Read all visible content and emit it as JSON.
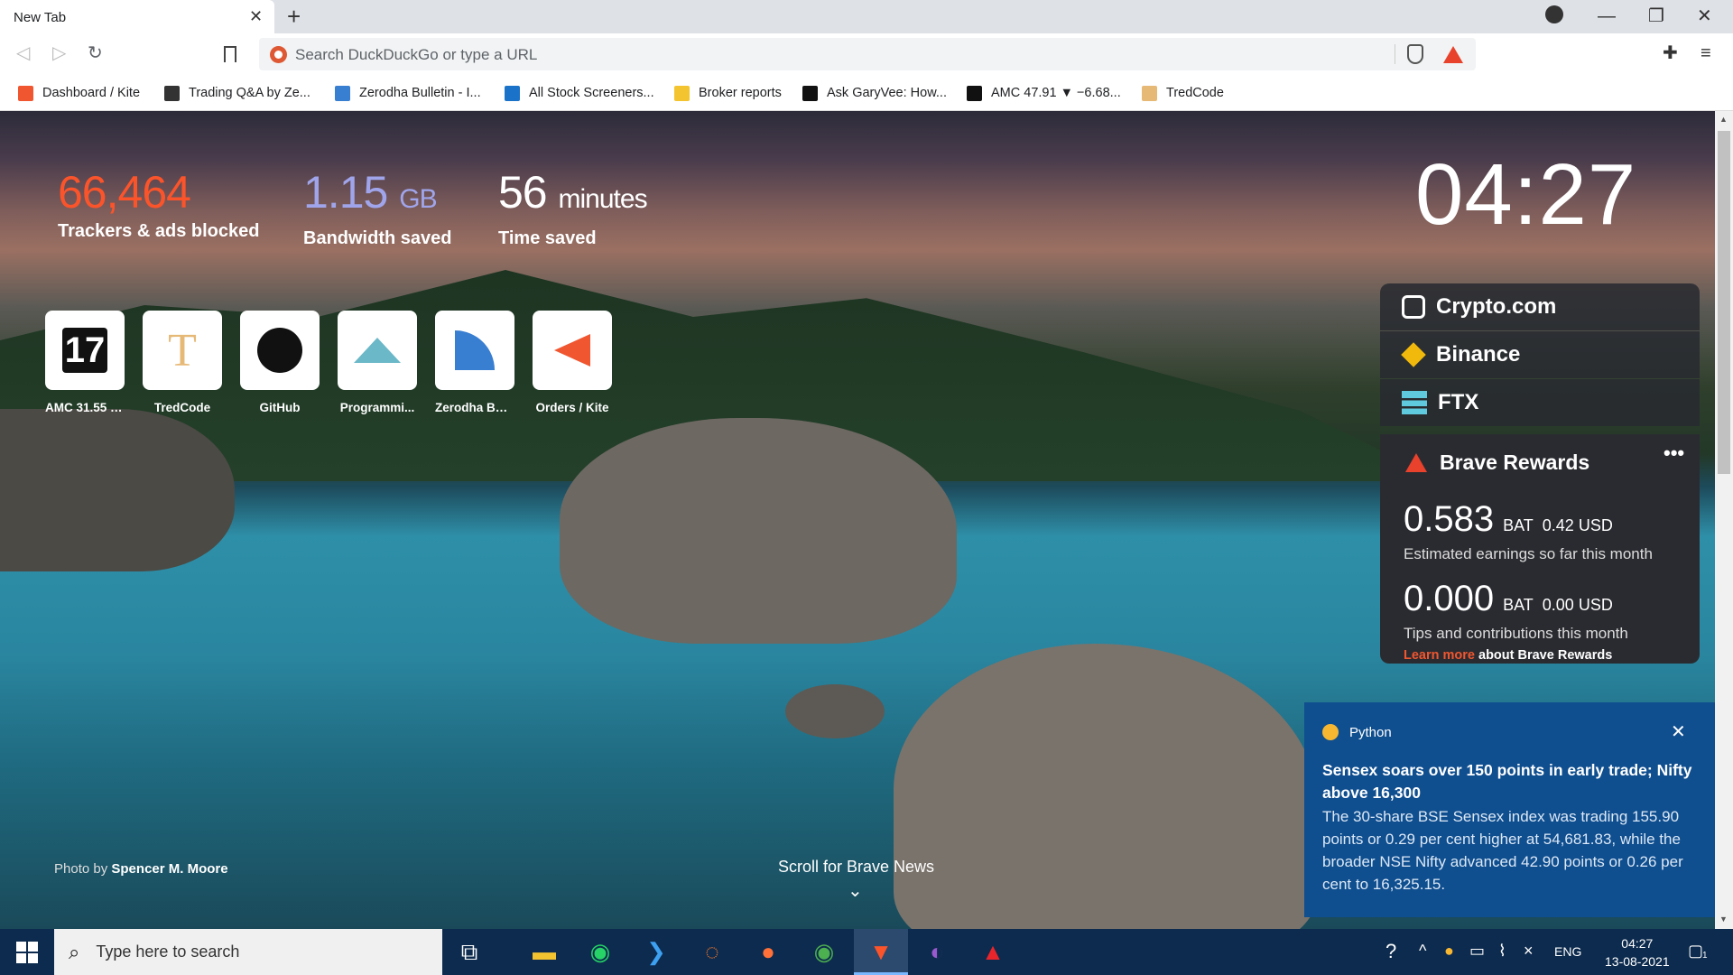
{
  "tab": {
    "title": "New Tab"
  },
  "omnibox": {
    "placeholder": "Search DuckDuckGo or type a URL"
  },
  "bookmarks": [
    {
      "label": "Dashboard / Kite",
      "icon": "kite-icon",
      "color": "#f0562f"
    },
    {
      "label": "Trading Q&A by Ze...",
      "icon": "tradingqa-icon",
      "color": "#333333"
    },
    {
      "label": "Zerodha Bulletin - I...",
      "icon": "zerodha-bulletin-icon",
      "color": "#387ed1"
    },
    {
      "label": "All Stock Screeners...",
      "icon": "chartink-icon",
      "color": "#1a73c8"
    },
    {
      "label": "Broker reports",
      "icon": "folder-icon",
      "color": "#f4c430"
    },
    {
      "label": "Ask GaryVee: How...",
      "icon": "garyvee-icon",
      "color": "#111111"
    },
    {
      "label": "AMC 47.91 ▼ −6.68...",
      "icon": "tradingview-icon",
      "color": "#111111"
    },
    {
      "label": "TredCode",
      "icon": "tredcode-icon",
      "color": "#e6b977"
    }
  ],
  "stats": {
    "trackers_value": "66,464",
    "trackers_label": "Trackers & ads blocked",
    "bandwidth_value": "1.15",
    "bandwidth_unit": "GB",
    "bandwidth_label": "Bandwidth saved",
    "time_value": "56",
    "time_unit": "minutes",
    "time_label": "Time saved",
    "trackers_color": "#fb542b",
    "bandwidth_color": "#a0a5eb"
  },
  "clock": "04:27",
  "top_sites": [
    {
      "label": "AMC 31.55 ▼...",
      "icon": "tradingview-icon"
    },
    {
      "label": "TredCode",
      "icon": "tredcode-icon"
    },
    {
      "label": "GitHub",
      "icon": "github-icon"
    },
    {
      "label": "Programmi...",
      "icon": "programming-icon"
    },
    {
      "label": "Zerodha Bull...",
      "icon": "zerodha-icon"
    },
    {
      "label": "Orders / Kite",
      "icon": "kite-icon"
    }
  ],
  "crypto_widgets": [
    {
      "label": "Crypto.com",
      "icon": "cryptocom-icon"
    },
    {
      "label": "Binance",
      "icon": "binance-icon"
    },
    {
      "label": "FTX",
      "icon": "ftx-icon"
    }
  ],
  "rewards": {
    "title": "Brave Rewards",
    "menu": "•••",
    "earn_amount": "0.583",
    "earn_unit": "BAT",
    "earn_usd": "0.42 USD",
    "earn_desc": "Estimated earnings so far this month",
    "tips_amount": "0.000",
    "tips_unit": "BAT",
    "tips_usd": "0.00 USD",
    "tips_desc": "Tips and contributions this month",
    "learn_more": "Learn more",
    "learn_rest": " about Brave Rewards"
  },
  "notification": {
    "app": "Python",
    "close": "✕",
    "headline": "Sensex soars over 150 points in early trade; Nifty above 16,300",
    "body": "The 30-share BSE Sensex index was trading 155.90 points or 0.29 per cent higher at 54,681.83, while the broader NSE Nifty advanced 42.90 points or 0.26 per cent to 16,325.15."
  },
  "photo_credit": {
    "prefix": "Photo by ",
    "name": "Spencer M. Moore"
  },
  "scroll_news": "Scroll for Brave News",
  "taskbar": {
    "search_placeholder": "Type here to search",
    "lang": "ENG",
    "time": "04:27",
    "date": "13-08-2021",
    "notif_count": "1",
    "apps": [
      {
        "name": "task-view-icon",
        "glyph": "⧉",
        "color": "#ffffff"
      },
      {
        "name": "file-explorer-icon",
        "glyph": "▬",
        "color": "#f4c430"
      },
      {
        "name": "whatsapp-icon",
        "glyph": "◉",
        "color": "#25d366"
      },
      {
        "name": "vscode-icon",
        "glyph": "❯",
        "color": "#3da0f0"
      },
      {
        "name": "jupyter-icon",
        "glyph": "◌",
        "color": "#f37726"
      },
      {
        "name": "firefox-icon",
        "glyph": "●",
        "color": "#ff7139"
      },
      {
        "name": "chrome-icon",
        "glyph": "◉",
        "color": "#4caf50"
      },
      {
        "name": "brave-icon",
        "glyph": "▼",
        "color": "#fb542b"
      },
      {
        "name": "tor-icon",
        "glyph": "◐",
        "color": "#9b59d0"
      },
      {
        "name": "acrobat-icon",
        "glyph": "▲",
        "color": "#e8252b"
      }
    ]
  }
}
